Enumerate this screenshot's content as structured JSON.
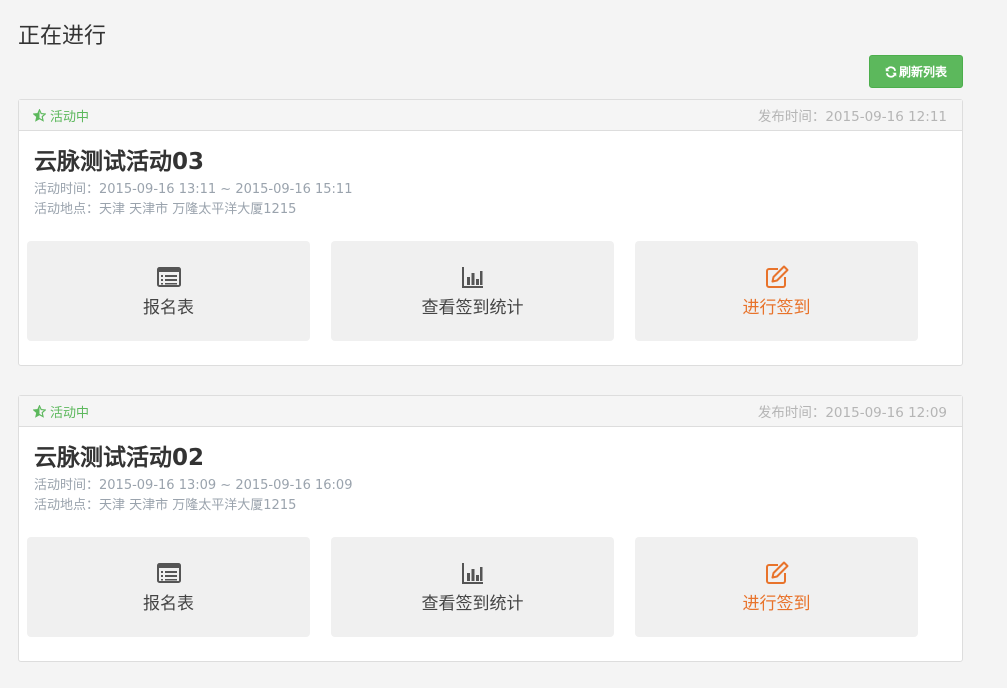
{
  "page": {
    "title": "正在进行"
  },
  "toolbar": {
    "refresh_label": "刷新列表"
  },
  "colors": {
    "green": "#5cb85c",
    "orange": "#e8732b",
    "muted": "#9aa3ad"
  },
  "events": [
    {
      "status": "活动中",
      "publish_label": "发布时间：",
      "publish_time": "2015-09-16 12:11",
      "title": "云脉测试活动03",
      "time_label": "活动时间：",
      "time": "2015-09-16 13:11 ~ 2015-09-16 15:11",
      "location_label": "活动地点：",
      "location": "天津 天津市 万隆太平洋大厦1215",
      "actions": [
        {
          "label": "报名表",
          "icon": "list-icon"
        },
        {
          "label": "查看签到统计",
          "icon": "bar-chart-icon"
        },
        {
          "label": "进行签到",
          "icon": "edit-icon"
        }
      ]
    },
    {
      "status": "活动中",
      "publish_label": "发布时间：",
      "publish_time": "2015-09-16 12:09",
      "title": "云脉测试活动02",
      "time_label": "活动时间：",
      "time": "2015-09-16 13:09 ~ 2015-09-16 16:09",
      "location_label": "活动地点：",
      "location": "天津 天津市 万隆太平洋大厦1215",
      "actions": [
        {
          "label": "报名表",
          "icon": "list-icon"
        },
        {
          "label": "查看签到统计",
          "icon": "bar-chart-icon"
        },
        {
          "label": "进行签到",
          "icon": "edit-icon"
        }
      ]
    }
  ]
}
